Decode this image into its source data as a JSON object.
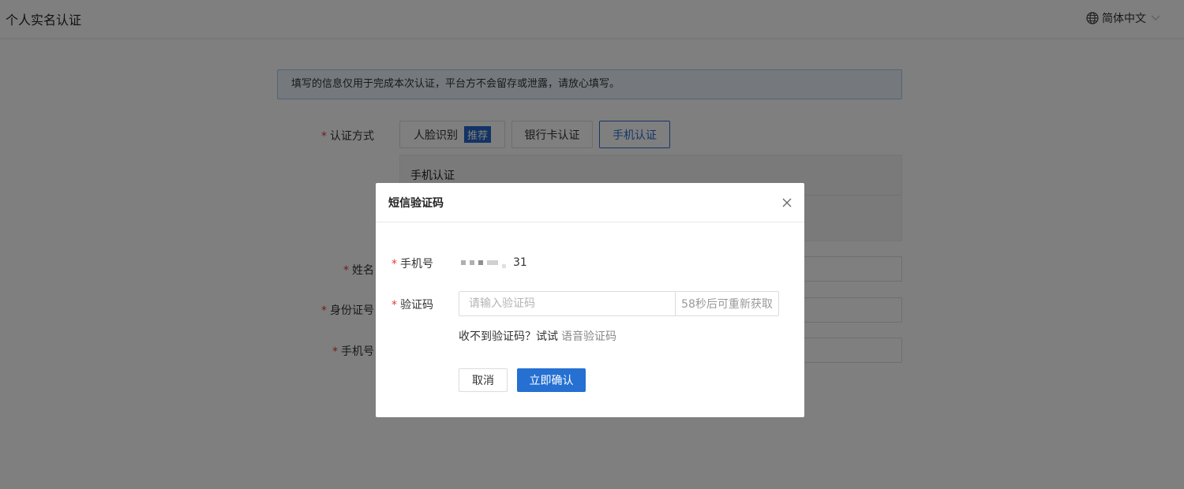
{
  "header": {
    "title": "个人实名认证",
    "language": "简体中文"
  },
  "notice": "填写的信息仅用于完成本次认证，平台方不会留存或泄露，请放心填写。",
  "form": {
    "method_label": "认证方式",
    "methods": [
      {
        "label": "人脸识别",
        "badge": "推荐"
      },
      {
        "label": "银行卡认证"
      },
      {
        "label": "手机认证",
        "selected": true
      }
    ],
    "panel_title": "手机认证",
    "name_label": "姓名",
    "id_label": "身份证号",
    "phone_label": "手机号"
  },
  "modal": {
    "title": "短信验证码",
    "phone_label": "手机号",
    "phone_value_tail": "31",
    "code_label": "验证码",
    "code_placeholder": "请输入验证码",
    "resend_text": "58秒后可重新获取",
    "voice_prompt": "收不到验证码？试试",
    "voice_link": "语音验证码",
    "cancel_label": "取消",
    "confirm_label": "立即确认"
  },
  "colors": {
    "primary": "#2570d1",
    "required": "#e53935",
    "notice_bg": "#eaf2fb"
  }
}
